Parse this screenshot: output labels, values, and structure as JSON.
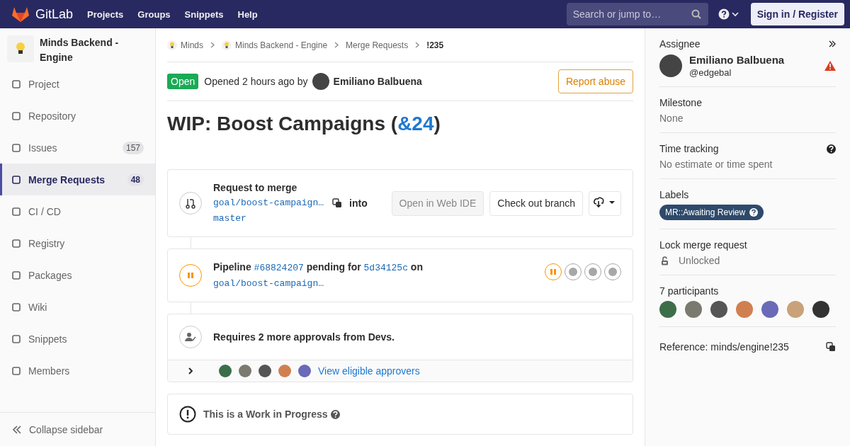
{
  "header": {
    "logo_text": "GitLab",
    "nav": [
      "Projects",
      "Groups",
      "Snippets",
      "Help"
    ],
    "search": {
      "placeholder": "Search or jump to…"
    },
    "sign_in": "Sign in / Register"
  },
  "sidebar": {
    "project_name": "Minds Backend - Engine",
    "items": [
      {
        "label": "Project",
        "selected": false
      },
      {
        "label": "Repository",
        "selected": false
      },
      {
        "label": "Issues",
        "badge": "157",
        "selected": false
      },
      {
        "label": "Merge Requests",
        "badge": "48",
        "selected": true
      },
      {
        "label": "CI / CD",
        "selected": false
      },
      {
        "label": "Registry",
        "selected": false
      },
      {
        "label": "Packages",
        "selected": false
      },
      {
        "label": "Wiki",
        "selected": false
      },
      {
        "label": "Snippets",
        "selected": false
      },
      {
        "label": "Members",
        "selected": false
      }
    ],
    "collapse": "Collapse sidebar"
  },
  "breadcrumbs": [
    "Minds",
    "Minds Backend - Engine",
    "Merge Requests",
    "!235"
  ],
  "mr": {
    "status": "Open",
    "opened_text": "Opened 2 hours ago by",
    "author": "Emiliano Balbuena",
    "report": "Report abuse",
    "title": "WIP: Boost Campaigns (",
    "title_link": "&24",
    "title_end": ")"
  },
  "merge_widget": {
    "heading": "Request to merge",
    "source_branch": "goal/boost-campaign…",
    "into": "into",
    "target_branch": "master",
    "web_ide": "Open in Web IDE",
    "checkout": "Check out branch"
  },
  "pipeline": {
    "label": "Pipeline",
    "id": "#68824207",
    "pending_for": "pending for",
    "commit": "5d34125c",
    "on": "on",
    "branch": "goal/boost-campaign…",
    "stages": [
      {
        "kind": "pending"
      },
      {
        "kind": "created"
      },
      {
        "kind": "created"
      },
      {
        "kind": "created"
      }
    ]
  },
  "approvals": {
    "text": "Requires 2 more approvals from Devs.",
    "expanded": false,
    "link": "View eligible approvers"
  },
  "wip": {
    "text": "This is a Work in Progress"
  },
  "right": {
    "assignee_label": "Assignee",
    "assignee_name": "Emiliano Balbuena",
    "assignee_handle": "@edgebal",
    "milestone_label": "Milestone",
    "milestone_value": "None",
    "time_label": "Time tracking",
    "time_value": "No estimate or time spent",
    "labels_label": "Labels",
    "labels": [
      {
        "text": "MR::Awaiting Review",
        "color": "#2e4a6b"
      }
    ],
    "lock_label": "Lock merge request",
    "lock_value": "Unlocked",
    "participants_label": "7 participants",
    "reference": "Reference: minds/engine!235"
  }
}
